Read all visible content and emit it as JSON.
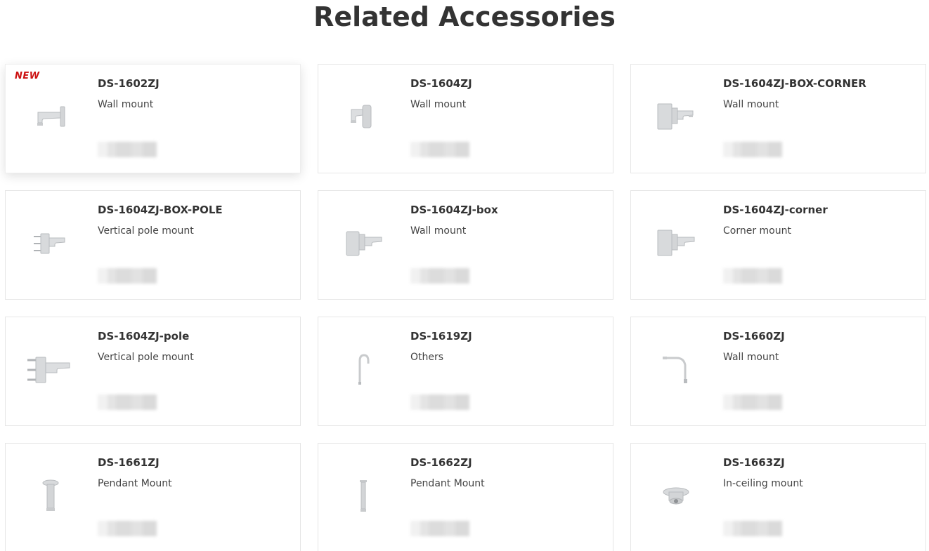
{
  "page": {
    "title": "Related Accessories"
  },
  "badge_new": "NEW",
  "colors": {
    "badge": "#cc1111",
    "text": "#333333",
    "card_border": "#e6e6e6",
    "accessory_gray": "#c9cbcd"
  },
  "products": [
    {
      "model": "DS-1602ZJ",
      "type": "Wall mount",
      "icon": "wall-mount-arm-icon",
      "new": true
    },
    {
      "model": "DS-1604ZJ",
      "type": "Wall mount",
      "icon": "wall-mount-short-icon",
      "new": false
    },
    {
      "model": "DS-1604ZJ-BOX-CORNER",
      "type": "Wall mount",
      "icon": "corner-box-mount-icon",
      "new": false
    },
    {
      "model": "DS-1604ZJ-BOX-POLE",
      "type": "Vertical pole mount",
      "icon": "pole-box-mount-icon",
      "new": false
    },
    {
      "model": "DS-1604ZJ-box",
      "type": "Wall mount",
      "icon": "box-wall-mount-icon",
      "new": false
    },
    {
      "model": "DS-1604ZJ-corner",
      "type": "Corner mount",
      "icon": "corner-mount-icon",
      "new": false
    },
    {
      "model": "DS-1604ZJ-pole",
      "type": "Vertical pole mount",
      "icon": "pole-mount-icon",
      "new": false
    },
    {
      "model": "DS-1619ZJ",
      "type": "Others",
      "icon": "gooseneck-icon",
      "new": false
    },
    {
      "model": "DS-1660ZJ",
      "type": "Wall mount",
      "icon": "long-arm-mount-icon",
      "new": false
    },
    {
      "model": "DS-1661ZJ",
      "type": "Pendant Mount",
      "icon": "pendant-short-icon",
      "new": false
    },
    {
      "model": "DS-1662ZJ",
      "type": "Pendant Mount",
      "icon": "pendant-long-icon",
      "new": false
    },
    {
      "model": "DS-1663ZJ",
      "type": "In-ceiling mount",
      "icon": "in-ceiling-mount-icon",
      "new": false
    }
  ]
}
